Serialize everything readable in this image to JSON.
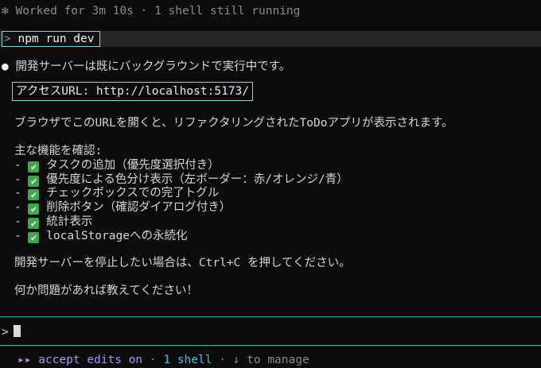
{
  "header": {
    "spinner_glyph": "✻",
    "status_text": "Worked for 3m 10s · 1 shell still running"
  },
  "command": {
    "prompt_glyph": ">",
    "text": "npm run dev"
  },
  "messages": {
    "bullet": "●",
    "intro": "開発サーバーは既にバックグラウンドで実行中です。",
    "access_url": "アクセスURL: http://localhost:5173/",
    "open_hint": "ブラウザでこのURLを開くと、リファクタリングされたToDoアプリが表示されます。",
    "features_title": "主な機能を確認:",
    "feature_dash": "-",
    "check_glyph": "✔",
    "features": [
      "タスクの追加（優先度選択付き）",
      "優先度による色分け表示（左ボーダー：赤/オレンジ/青）",
      "チェックボックスでの完了トグル",
      "削除ボタン（確認ダイアログ付き）",
      "統計表示",
      "localStorageへの永続化"
    ],
    "stop_hint": "開発サーバーを停止したい場合は、Ctrl+C を押してください。",
    "closing": "何か問題があれば教えてください！"
  },
  "input": {
    "prompt_glyph": ">"
  },
  "statusbar": {
    "mode_glyph": "▸▸",
    "mode_label": "accept edits on",
    "shell_count": "1 shell",
    "hint": "↓ to manage",
    "separator": "·"
  },
  "colors": {
    "accent": "#b18cf0",
    "teal": "#3fc2d8",
    "check": "#3fa84a",
    "border": "#7fd6e6"
  }
}
